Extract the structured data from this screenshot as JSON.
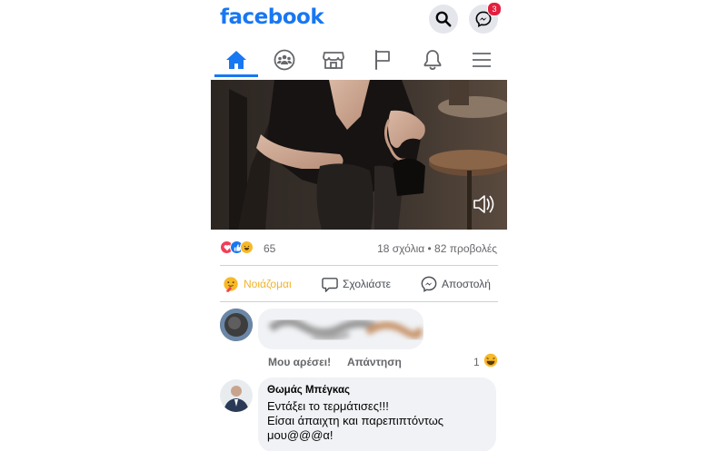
{
  "header": {
    "logo": "facebook",
    "messenger_badge": "3"
  },
  "nav": {
    "items": [
      "home-icon",
      "groups-icon",
      "marketplace-icon",
      "pages-flag-icon",
      "notifications-bell-icon",
      "menu-icon"
    ],
    "active_index": 0,
    "active_color": "#1877f2"
  },
  "post": {
    "reaction_count": "65",
    "comments_views": "18 σχόλια • 82 προβολές",
    "actions": {
      "care_label": "Νοιάζομαι",
      "comment_label": "Σχολιάστε",
      "share_label": "Αποστολή"
    }
  },
  "comments": [
    {
      "like_label": "Μου αρέσει!",
      "reply_label": "Απάντηση",
      "reaction_count": "1"
    },
    {
      "author": "Θωμάς Μπέγκας",
      "text": "Εντάξει το τερμάτισες!!!\nΕίσαι άπαιχτη και παρεπιπτόντως μου@@@α!"
    }
  ],
  "colors": {
    "brand": "#1877f2",
    "care": "#f0b429",
    "badge": "#e41e3f"
  }
}
